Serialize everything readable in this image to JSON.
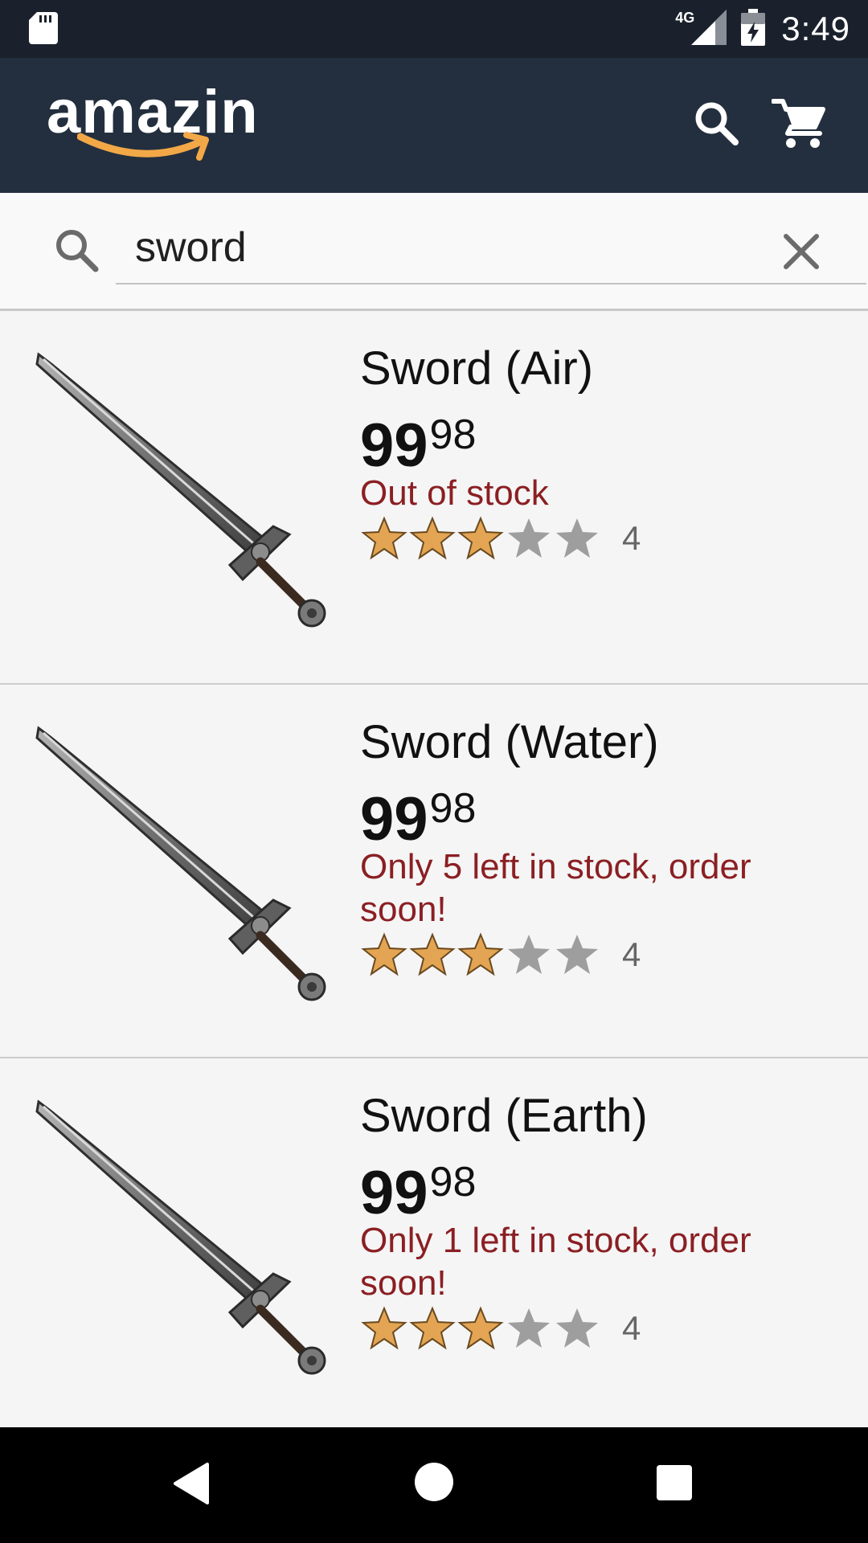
{
  "status_bar": {
    "time": "3:49",
    "network": "4G",
    "sd_icon": "sd-card-icon",
    "signal_icon": "signal-icon",
    "battery_icon": "battery-charging-icon"
  },
  "app_bar": {
    "logo_text": "amazin",
    "brand_color": "#232f3e",
    "smile_color": "#f3a847",
    "search_icon": "search-icon",
    "cart_icon": "cart-icon"
  },
  "search": {
    "value": "sword",
    "search_icon": "search-icon",
    "clear_icon": "close-icon"
  },
  "results": [
    {
      "title": "Sword (Air)",
      "price_whole": "99",
      "price_fraction": "98",
      "stock": "Out of stock",
      "rating": 3,
      "rating_count": "4"
    },
    {
      "title": "Sword (Water)",
      "price_whole": "99",
      "price_fraction": "98",
      "stock": "Only 5 left in stock, order soon!",
      "rating": 3,
      "rating_count": "4"
    },
    {
      "title": "Sword (Earth)",
      "price_whole": "99",
      "price_fraction": "98",
      "stock": "Only 1 left in stock, order soon!",
      "rating": 3,
      "rating_count": "4"
    }
  ],
  "colors": {
    "stock_text": "#8b1f23",
    "star_filled": "#e3a554",
    "star_empty": "#9e9e9e"
  },
  "nav_bar": {
    "back_icon": "back-icon",
    "home_icon": "home-icon",
    "recents_icon": "recents-icon"
  }
}
